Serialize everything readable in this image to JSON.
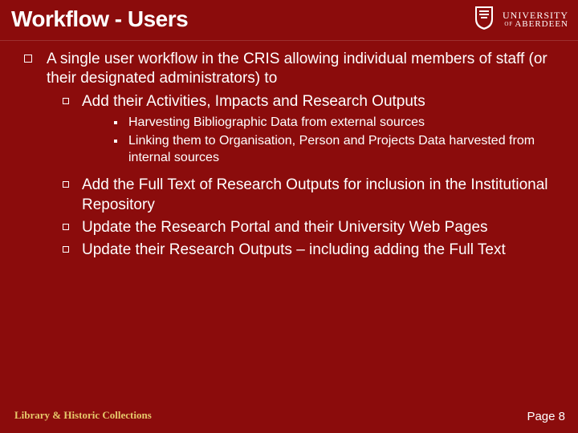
{
  "title": "Workflow - Users",
  "logo": {
    "line1": "UNIVERSITY",
    "of": "OF",
    "line2": "ABERDEEN"
  },
  "bullets": [
    {
      "text": "A single user workflow in the CRIS allowing individual members of staff (or their designated administrators) to",
      "children": [
        {
          "text": "Add their Activities, Impacts and Research Outputs",
          "children": [
            {
              "text": "Harvesting Bibliographic Data from external sources"
            },
            {
              "text": "Linking them to Organisation, Person and Projects Data harvested from internal sources"
            }
          ]
        },
        {
          "text": "Add the Full Text of Research Outputs for inclusion in the Institutional Repository"
        },
        {
          "text": "Update the Research Portal and their University Web Pages"
        },
        {
          "text": "Update their Research Outputs – including adding the Full Text"
        }
      ]
    }
  ],
  "footer": {
    "left": "Library & Historic Collections",
    "right": "Page 8"
  },
  "colors": {
    "background": "#8b0c0c",
    "text": "#ffffff",
    "accent": "#e6c96b"
  }
}
